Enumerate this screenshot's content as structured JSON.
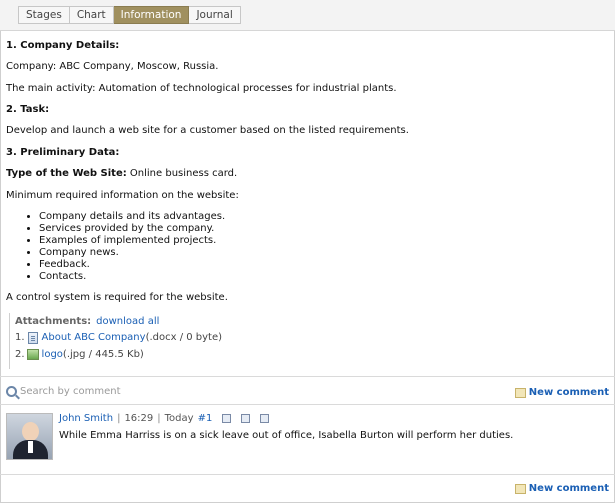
{
  "tabs": [
    {
      "label": "Stages",
      "active": false
    },
    {
      "label": "Chart",
      "active": false
    },
    {
      "label": "Information",
      "active": true
    },
    {
      "label": "Journal",
      "active": false
    }
  ],
  "info": {
    "s1_title": "1. Company Details:",
    "company": "Company: ABC Company, Moscow, Russia.",
    "activity": "The main activity: Automation of technological processes for industrial plants.",
    "s2_title": "2. Task:",
    "task": "Develop and launch a web site for a customer based on the listed requirements.",
    "s3_title": "3. Preliminary Data:",
    "type_label": "Type of the Web Site:",
    "type_value": " Online business card.",
    "min_info": "Minimum required information on the website:",
    "items": [
      "Company details and its advantages.",
      "Services provided by the company.",
      "Examples of implemented projects.",
      "Company news.",
      "Feedback.",
      "Contacts."
    ],
    "control": "A control system is required for the website."
  },
  "attachments": {
    "title": "Attachments:",
    "download_all": "download all",
    "files": [
      {
        "num": "1.",
        "name": "About ABC Company",
        "meta": "(.docx / 0 byte)",
        "icon": "document-icon"
      },
      {
        "num": "2.",
        "name": "logo",
        "meta": "(.jpg / 445.5 Kb)",
        "icon": "image-icon"
      }
    ]
  },
  "comments": {
    "search_placeholder": "Search by comment",
    "new_comment": "New comment",
    "list": [
      {
        "author": "John Smith",
        "time": "16:29",
        "day": "Today",
        "num": "#1",
        "text": "While Emma Harriss is on a sick leave out of office, Isabella Burton will perform her duties."
      }
    ]
  }
}
